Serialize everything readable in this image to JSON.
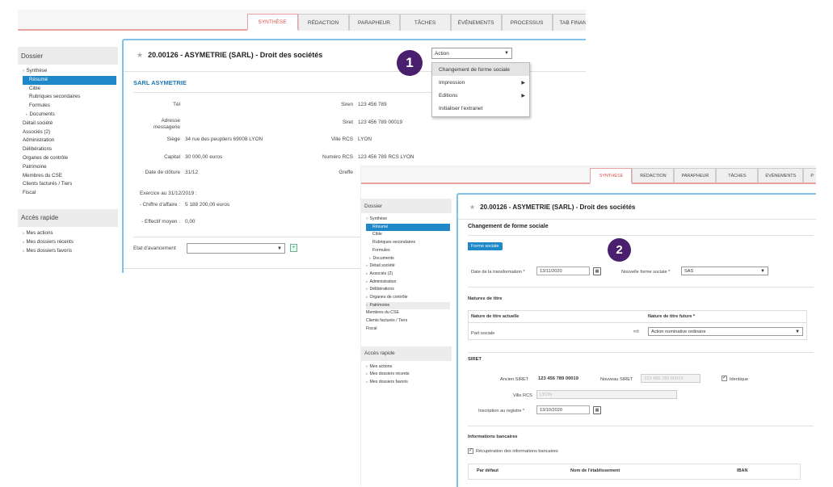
{
  "screen1": {
    "tabs": [
      "SYNTHÈSE",
      "RÉDACTION",
      "PARAPHEUR",
      "TÂCHES",
      "ÉVÉNEMENTS",
      "PROCESSUS",
      "TAB FINAN"
    ],
    "nav": {
      "header": "Dossier",
      "items": [
        "Synthèse",
        "Résumé",
        "Cible",
        "Rubriques secondaires",
        "Formules",
        "Documents",
        "Détail société",
        "Associés (2)",
        "Administration",
        "Délibérations",
        "Organes de contrôle",
        "Patrimoine",
        "Membres du CSE",
        "Clients facturés / Tiers",
        "Fiscal"
      ],
      "quick_header": "Accès rapide",
      "quick_items": [
        "Mes actions",
        "Mes dossiers récents",
        "Mes dossiers favoris"
      ]
    },
    "title": "20.00126 - ASYMETRIE (SARL) - Droit des sociétés",
    "company_heading": "SARL ASYMETRIE",
    "action_label": "Action",
    "action_menu": [
      "Changement de forme sociale",
      "Impression",
      "Editions",
      "Initialiser l'extranet"
    ],
    "badge": "1",
    "fields": {
      "tel_label": "Tél",
      "adresse_label": "Adresse messagerie",
      "siege_label": "Siège",
      "siege_value": "34 rue des peupliers 69008 LYON",
      "capital_label": "Capital",
      "capital_value": "30 000,00 euros",
      "date_cloture_label": "Date de clôture",
      "date_cloture_value": "31/12",
      "exercice": "Exercice au 31/12/2019 :",
      "ca_label": "- Chiffre d'affaire :",
      "ca_value": "5 188 200,00 euros",
      "effectif_label": "- Effectif moyen :",
      "effectif_value": "0,00",
      "siren_label": "Siren",
      "siren_value": "123 456 789",
      "siret_label": "Siret",
      "siret_value": "123 456 789 00019",
      "ville_rcs_label": "Ville RCS",
      "ville_rcs_value": "LYON",
      "numero_rcs_label": "Numéro RCS",
      "numero_rcs_value": "123 456 789 RCS LYON",
      "greffe_label": "Greffe"
    },
    "etat_label": "Etat d'avancement"
  },
  "screen2": {
    "tabs": [
      "SYNTHÈSE",
      "RÉDACTION",
      "PARAPHEUR",
      "TÂCHES",
      "ÉVÉNEMENTS",
      "P"
    ],
    "nav": {
      "header": "Dossier",
      "items": [
        "Synthèse",
        "Résumé",
        "Cible",
        "Rubriques secondaires",
        "Formules",
        "Documents",
        "Détail société",
        "Associés (2)",
        "Administration",
        "Délibérations",
        "Organes de contrôle",
        "Patrimoine",
        "Membres du CSE",
        "Clients facturés / Tiers",
        "Fiscal"
      ],
      "quick_header": "Accès rapide",
      "quick_items": [
        "Mes actions",
        "Mes dossiers récents",
        "Mes dossiers favoris"
      ]
    },
    "title": "20.00126 - ASYMETRIE (SARL) - Droit des sociétés",
    "subtitle": "Changement de forme sociale",
    "chip": "Forme sociale",
    "badge": "2",
    "date_transfo_label": "Date de la transformation *",
    "date_transfo_value": "13/11/2020",
    "nouvelle_forme_label": "Nouvelle forme sociale *",
    "nouvelle_forme_value": "SAS",
    "natures_title": "Natures de titre",
    "col_actuelle": "Nature de titre actuelle",
    "col_future": "Nature de titre future *",
    "row_actuelle": "Part sociale",
    "row_future": "Action nominative ordinaire",
    "siret_title": "SIRET",
    "ancien_siret_label": "Ancien SIRET",
    "ancien_siret_value": "123 456 789 00019",
    "nouveau_siret_label": "Nouveau SIRET",
    "nouveau_siret_placeholder": "123 456 789 00019",
    "identique_label": "Identique",
    "ville_rcs_label": "Ville RCS",
    "ville_rcs_value": "LYON",
    "inscription_label": "Inscription au registre *",
    "inscription_value": "13/10/2020",
    "banque_title": "Informations bancaires",
    "recup_label": "Récupération des informations bancaires",
    "col_defaut": "Par défaut",
    "col_etab": "Nom de l'établissement",
    "col_iban": "IBAN"
  }
}
